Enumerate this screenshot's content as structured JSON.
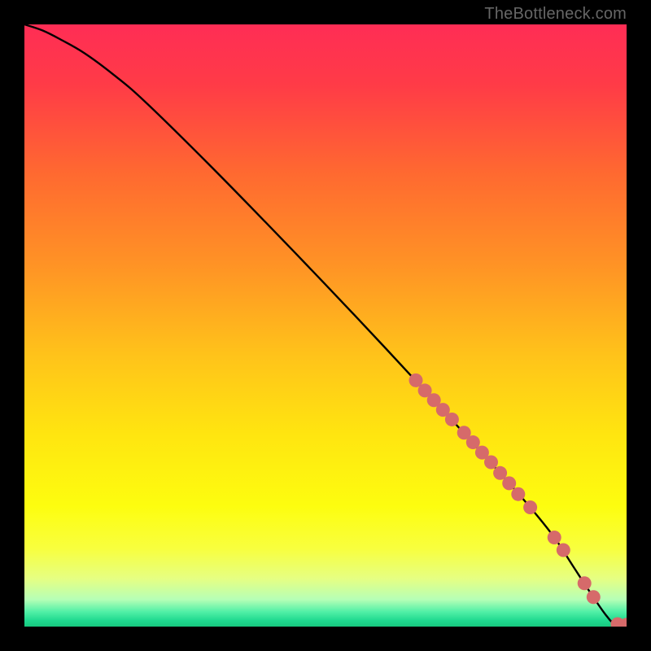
{
  "watermark": "TheBottleneck.com",
  "colors": {
    "gradient_stops": [
      {
        "offset": 0.0,
        "color": "#ff2d55"
      },
      {
        "offset": 0.1,
        "color": "#ff3b47"
      },
      {
        "offset": 0.25,
        "color": "#ff6a30"
      },
      {
        "offset": 0.4,
        "color": "#ff9325"
      },
      {
        "offset": 0.55,
        "color": "#ffc31a"
      },
      {
        "offset": 0.68,
        "color": "#ffe510"
      },
      {
        "offset": 0.8,
        "color": "#fdfd0f"
      },
      {
        "offset": 0.87,
        "color": "#f8ff3e"
      },
      {
        "offset": 0.92,
        "color": "#e6ff82"
      },
      {
        "offset": 0.955,
        "color": "#b6ffb6"
      },
      {
        "offset": 0.975,
        "color": "#53f0a7"
      },
      {
        "offset": 0.99,
        "color": "#1fd98f"
      },
      {
        "offset": 1.0,
        "color": "#18c97f"
      }
    ],
    "line_color": "#000000",
    "dot_color": "#d66a6a"
  },
  "chart_data": {
    "type": "line",
    "title": "",
    "xlabel": "",
    "ylabel": "",
    "xlim": [
      0,
      100
    ],
    "ylim": [
      0,
      100
    ],
    "grid": false,
    "series": [
      {
        "name": "curve",
        "x": [
          0,
          3,
          6,
          10,
          15,
          20,
          30,
          40,
          50,
          60,
          70,
          78,
          84,
          88,
          91,
          94,
          96.5,
          98,
          100
        ],
        "y": [
          100,
          99,
          97.5,
          95.2,
          91.5,
          87.2,
          77.4,
          67.2,
          56.8,
          46.2,
          35.4,
          26.6,
          19.8,
          14.8,
          10.2,
          5.6,
          2.0,
          0.5,
          0.3
        ]
      },
      {
        "name": "highlight-dots",
        "x": [
          65,
          66.5,
          68,
          69.5,
          71,
          73,
          74.5,
          76,
          77.5,
          79,
          80.5,
          82,
          84,
          88,
          89.5,
          93,
          94.5,
          98.5,
          100
        ],
        "y": [
          40.9,
          39.2,
          37.6,
          36.0,
          34.4,
          32.2,
          30.6,
          28.9,
          27.3,
          25.5,
          23.8,
          22.0,
          19.8,
          14.8,
          12.7,
          7.2,
          4.9,
          0.4,
          0.3
        ]
      }
    ]
  }
}
